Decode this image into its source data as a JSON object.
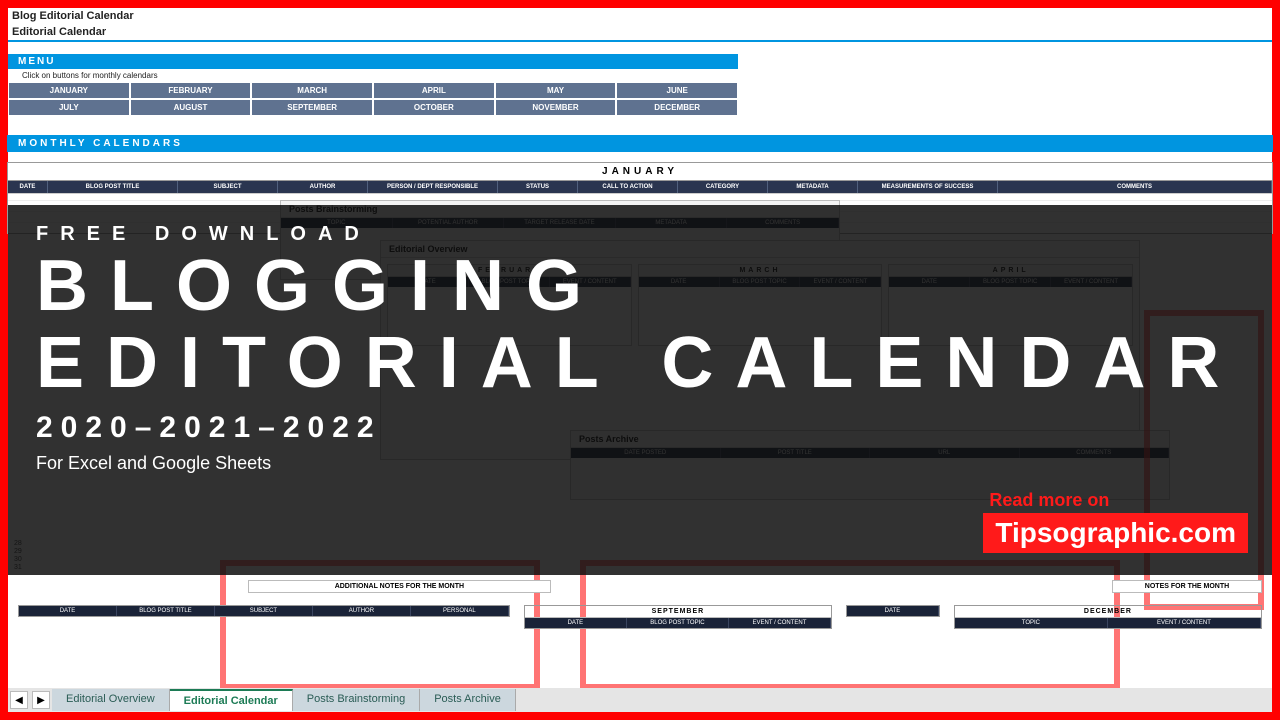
{
  "doc": {
    "title": "Blog Editorial Calendar",
    "subtitle": "Editorial Calendar"
  },
  "menu": {
    "label": "MENU",
    "note": "Click on buttons for monthly calendars",
    "row1": [
      "JANUARY",
      "FEBRUARY",
      "MARCH",
      "APRIL",
      "MAY",
      "JUNE"
    ],
    "row2": [
      "JULY",
      "AUGUST",
      "SEPTEMBER",
      "OCTOBER",
      "NOVEMBER",
      "DECEMBER"
    ]
  },
  "mc_label": "MONTHLY CALENDARS",
  "january": {
    "title": "JANUARY",
    "cols": [
      "DATE",
      "BLOG POST TITLE",
      "SUBJECT",
      "AUTHOR",
      "PERSON / DEPT RESPONSIBLE",
      "STATUS",
      "CALL TO ACTION",
      "CATEGORY",
      "METADATA",
      "MEASUREMENTS OF SUCCESS",
      "COMMENTS"
    ]
  },
  "panels": {
    "posts_brainstorm": {
      "title": "Posts Brainstorming",
      "cols": [
        "TOPIC",
        "POTENTIAL AUTHOR",
        "TARGET RELEASE DATE",
        "METADATA",
        "COMMENTS"
      ]
    },
    "editorial_overview": {
      "title": "Editorial Overview",
      "mini": {
        "labels": [
          "FEBRUARY",
          "MARCH",
          "APRIL"
        ],
        "cols": [
          "DATE",
          "BLOG POST TOPIC",
          "EVENT / CONTENT"
        ]
      },
      "notes": "ADDITIONAL NOTES FOR THE MONTH",
      "notes_right": "NOTES FOR THE MONTH"
    },
    "posts_archive": {
      "title": "Posts Archive",
      "cols": [
        "DATE POSTED",
        "POST TITLE",
        "URL",
        "COMMENTS"
      ]
    }
  },
  "bottom": {
    "dates_start": 28,
    "dates": [
      "28",
      "29",
      "30",
      "31"
    ],
    "footer_blocks": [
      {
        "title": "",
        "cols": [
          "DATE",
          "BLOG POST TITLE",
          "SUBJECT",
          "AUTHOR",
          "PERSONAL"
        ]
      },
      {
        "title": "SEPTEMBER",
        "cols": [
          "DATE",
          "BLOG POST TOPIC",
          "EVENT / CONTENT"
        ]
      },
      {
        "title": "",
        "cols": [
          "DATE"
        ]
      },
      {
        "title": "DECEMBER",
        "cols": [
          "TOPIC",
          "EVENT / CONTENT"
        ]
      }
    ]
  },
  "tabs": {
    "items": [
      "Editorial Overview",
      "Editorial Calendar",
      "Posts Brainstorming",
      "Posts Archive"
    ],
    "active_index": 1
  },
  "overlay": {
    "kicker": "FREE DOWNLOAD",
    "main1": "BLOGGING",
    "main2": "EDITORIAL CALENDAR",
    "years": "2020–2021–2022",
    "subtitle": "For Excel and Google Sheets",
    "brand_top": "Read more on",
    "brand": "Tipsographic.com"
  }
}
